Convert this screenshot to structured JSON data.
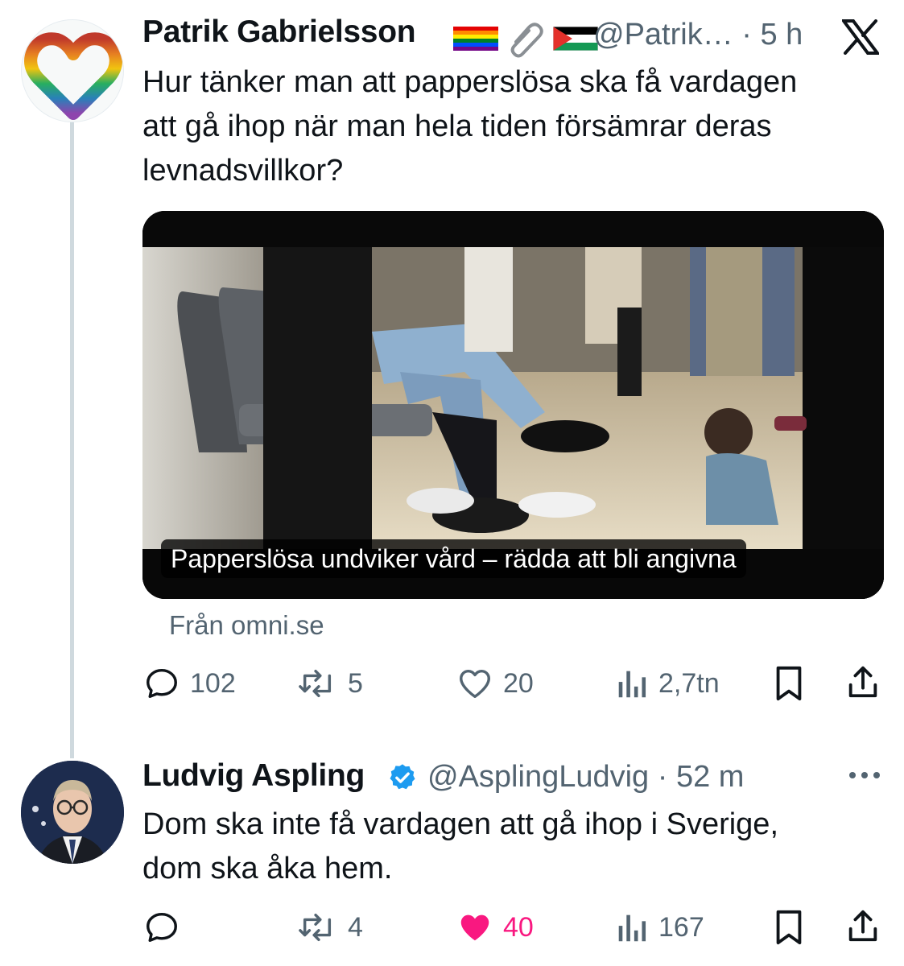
{
  "tweet1": {
    "display_name": "Patrik Gabrielsson",
    "handle_time": "@Patrik… · 5 h",
    "avatar_icon": "rainbow-heart-hands",
    "emoji_icons": [
      "rainbow-flag-icon",
      "paperclip-icon",
      "palestine-flag-icon"
    ],
    "platform_icon": "x-logo-icon",
    "text": "Hur tänker man att papperslösa ska få vardagen\natt gå ihop när man hela tiden försämrar deras\nlevnadsvillkor?",
    "card": {
      "caption": "Papperslösa undviker vård – rädda att bli angivna",
      "source": "Från omni.se"
    },
    "actions": {
      "replies": "102",
      "reposts": "5",
      "likes": "20",
      "views": "2,7tn"
    }
  },
  "tweet2": {
    "display_name": "Ludvig Aspling",
    "verified": true,
    "handle_time": "@AsplingLudvig · 52 m",
    "more_icon": "more-dots-icon",
    "text": "Dom ska inte få vardagen att gå ihop i Sverige,\ndom ska åka hem.",
    "actions": {
      "replies": "",
      "reposts": "4",
      "likes": "40",
      "views": "167"
    },
    "liked": true
  },
  "colors": {
    "text": "#0f1419",
    "secondary": "#536471",
    "thread_line": "#cfd9de",
    "verified_blue": "#1d9bf0",
    "like_pink": "#f91880"
  }
}
